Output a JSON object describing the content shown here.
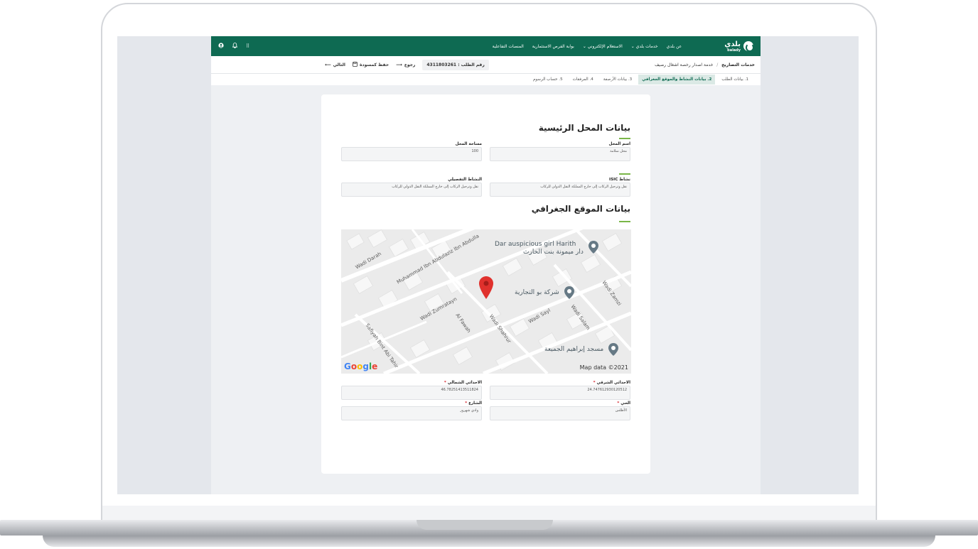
{
  "header": {
    "logo_text": "بلدي",
    "logo_sub": "balady",
    "nav": [
      "عن بلدي",
      "خدمات بلدي ⌄",
      "الاستعلام الإلكتروني ⌄",
      "بوابة الفرص الاستثمارية",
      "المنصات التفاعلية"
    ],
    "icons": [
      "grid-icon",
      "bell-icon",
      "user-icon"
    ]
  },
  "infobar": {
    "crumb_root": "خدمات التصاريح",
    "crumb_sep": "/",
    "crumb_current": "خدمة اصدار رخصة اشغال رصيف",
    "request_number": "رقم الطلب : 4311803261",
    "back_label": "رجوع",
    "save_draft_label": "حفظ كمسودة",
    "next_label": "التالي"
  },
  "steps": [
    {
      "label": "1. بيانات الطلب",
      "active": false
    },
    {
      "label": "2. بيانات النشاط والموقع الجغرافي",
      "active": true
    },
    {
      "label": "3. بيانات الأرصفة",
      "active": false
    },
    {
      "label": "4. المرفقات",
      "active": false
    },
    {
      "label": "5. حساب الرسوم",
      "active": false
    }
  ],
  "main_section": {
    "title": "بيانات المحل الرئيسية",
    "shop_name_label": "اسم المحل",
    "shop_name_value": "محل سلامة",
    "area_label": "مساحة المحل",
    "area_value": "100",
    "isic_label": "نشاط ISIC",
    "isic_value": "نقل وترحيل الركاب إلى خارج المملكة النقل الدولي للركاب",
    "detail_label": "النشاط التفصيلي",
    "detail_value": "نقل وترحيل الركاب إلى خارج المملكة النقل الدولي للركاب"
  },
  "geo_section": {
    "title": "بيانات الموقع الجغرافي",
    "east_label": "الاحداثي الشرقي",
    "east_value": "24.747612930120512",
    "north_label": "الاحداثي الشمالي",
    "north_value": "46.78251413511824",
    "district_label": "الحي",
    "district_value": "الأطلس",
    "street_label": "الشارع",
    "street_value": "وادي شهرور",
    "required_mark": "*"
  },
  "map": {
    "labels": [
      "Wadi Darah",
      "Muhammad Ibn Abdulaziz Ibn Abdulla",
      "Wadi Zumratayn",
      "Al Fawah",
      "Wadi Shahrur",
      "Wadi Sayl",
      "Wadi Salam",
      "Wadi Zamzi",
      "Safiyah Bint Abi Tahir"
    ],
    "poi_1_en": "Dar auspicious girl Harith",
    "poi_1_ar": "دار ميمونة بنت الحارث",
    "poi_2": "شركة بو التجارية",
    "poi_3": "مسجد إبراهيم الجميعة",
    "google": [
      "G",
      "o",
      "o",
      "g",
      "l",
      "e"
    ],
    "attribution": "Map data ©2021",
    "pin_color": "#e0312d"
  },
  "colors": {
    "brand_green": "#0e6a52",
    "accent_line": "#7ab648",
    "required_red": "#d6262e"
  }
}
